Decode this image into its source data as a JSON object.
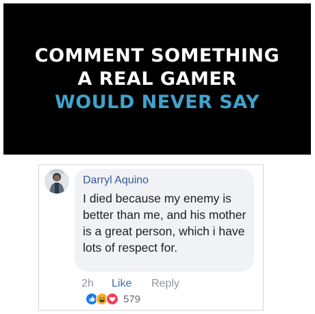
{
  "banner": {
    "line1": "COMMENT SOMETHING",
    "line2": "A REAL GAMER",
    "line3": "WOULD NEVER SAY"
  },
  "comment": {
    "author": "Darryl Aquino",
    "text": "I died because my enemy is better than me, and his mother is a great person, which i have lots of respect for.",
    "time": "2h",
    "like_label": "Like",
    "reply_label": "Reply",
    "reaction_count": "579",
    "reactions": [
      "like-reaction-icon",
      "haha-reaction-icon",
      "love-reaction-icon"
    ]
  },
  "colors": {
    "accent_line": "#3fa3cc",
    "author": "#385898",
    "like": "#4267b2",
    "bubble": "#f0f2f5"
  }
}
